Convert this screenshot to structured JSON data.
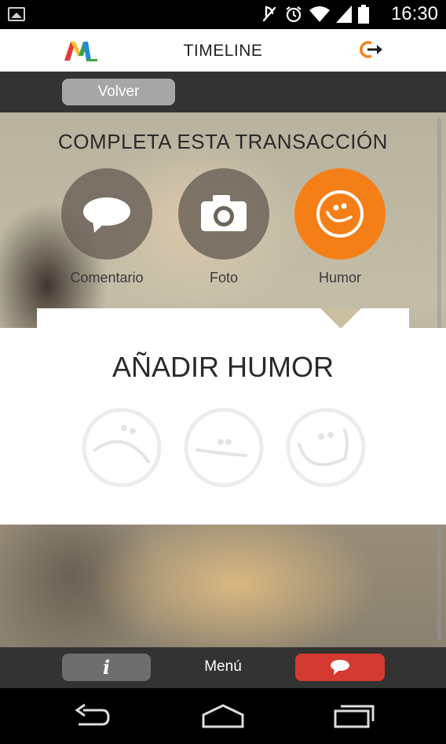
{
  "status_bar": {
    "time": "16:30",
    "icons": [
      "image-notification-icon",
      "mute-icon",
      "alarm-icon",
      "wifi-icon",
      "signal-icon",
      "battery-icon"
    ]
  },
  "header": {
    "title": "TIMELINE",
    "logo_colors": [
      "#e53935",
      "#fbc02d",
      "#43a047",
      "#1e88e5"
    ],
    "accent": "#f57f17"
  },
  "back_button": {
    "label": "Volver"
  },
  "transaction": {
    "heading": "COMPLETA ESTA TRANSACCIÓN",
    "options": [
      {
        "label": "Comentario",
        "icon": "speech-bubble-icon",
        "selected": false
      },
      {
        "label": "Foto",
        "icon": "camera-icon",
        "selected": false
      },
      {
        "label": "Humor",
        "icon": "smiley-icon",
        "selected": true
      }
    ]
  },
  "humor_panel": {
    "title": "AÑADIR HUMOR",
    "moods": [
      {
        "name": "sad",
        "icon": "sad-face-icon"
      },
      {
        "name": "neutral",
        "icon": "neutral-face-icon"
      },
      {
        "name": "happy",
        "icon": "happy-face-icon"
      }
    ]
  },
  "bottom_bar": {
    "info_label": "i",
    "menu_label": "Menú",
    "chat_icon": "chat-bubble-icon",
    "colors": {
      "info": "#6e6e6e",
      "chat": "#d43a31"
    }
  },
  "nav_bar": {
    "icons": [
      "back-icon",
      "home-icon",
      "recent-apps-icon"
    ]
  }
}
